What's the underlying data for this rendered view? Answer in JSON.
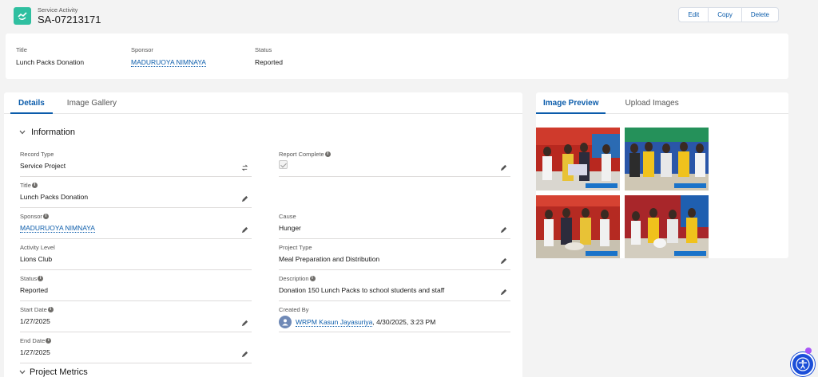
{
  "header": {
    "object_label": "Service Activity",
    "record_name": "SA-07213171",
    "actions": [
      "Edit",
      "Copy",
      "Delete"
    ]
  },
  "highlights": [
    {
      "label": "Title",
      "value": "Lunch Packs Donation"
    },
    {
      "label": "Sponsor",
      "value": "MADURUOYA NIMNAYA"
    },
    {
      "label": "Status",
      "value": "Reported"
    }
  ],
  "main_tabs": [
    "Details",
    "Image Gallery"
  ],
  "section_title": "Information",
  "fields": {
    "record_type": {
      "label": "Record Type",
      "value": "Service Project"
    },
    "report_complete": {
      "label": "Report Complete",
      "checked": true
    },
    "title": {
      "label": "Title",
      "value": "Lunch Packs Donation"
    },
    "sponsor": {
      "label": "Sponsor",
      "value": "MADURUOYA NIMNAYA"
    },
    "cause": {
      "label": "Cause",
      "value": "Hunger"
    },
    "activity_level": {
      "label": "Activity Level",
      "value": "Lions Club"
    },
    "project_type": {
      "label": "Project Type",
      "value": "Meal Preparation and Distribution"
    },
    "status": {
      "label": "Status",
      "value": "Reported"
    },
    "description": {
      "label": "Description",
      "value": "Donation 150 Lunch Packs to school students and staff"
    },
    "start_date": {
      "label": "Start Date",
      "value": "1/27/2025"
    },
    "created_by": {
      "label": "Created By",
      "user": "WRPM Kasun Jayasuriya",
      "timestamp": ", 4/30/2025, 3:23 PM"
    },
    "end_date": {
      "label": "End Date",
      "value": "1/27/2025"
    }
  },
  "next_section_title": "Project Metrics",
  "side_tabs": [
    "Image Preview",
    "Upload Images"
  ],
  "colors": {
    "accent": "#0b5cab",
    "brand_icon": "#2fbfa0"
  }
}
